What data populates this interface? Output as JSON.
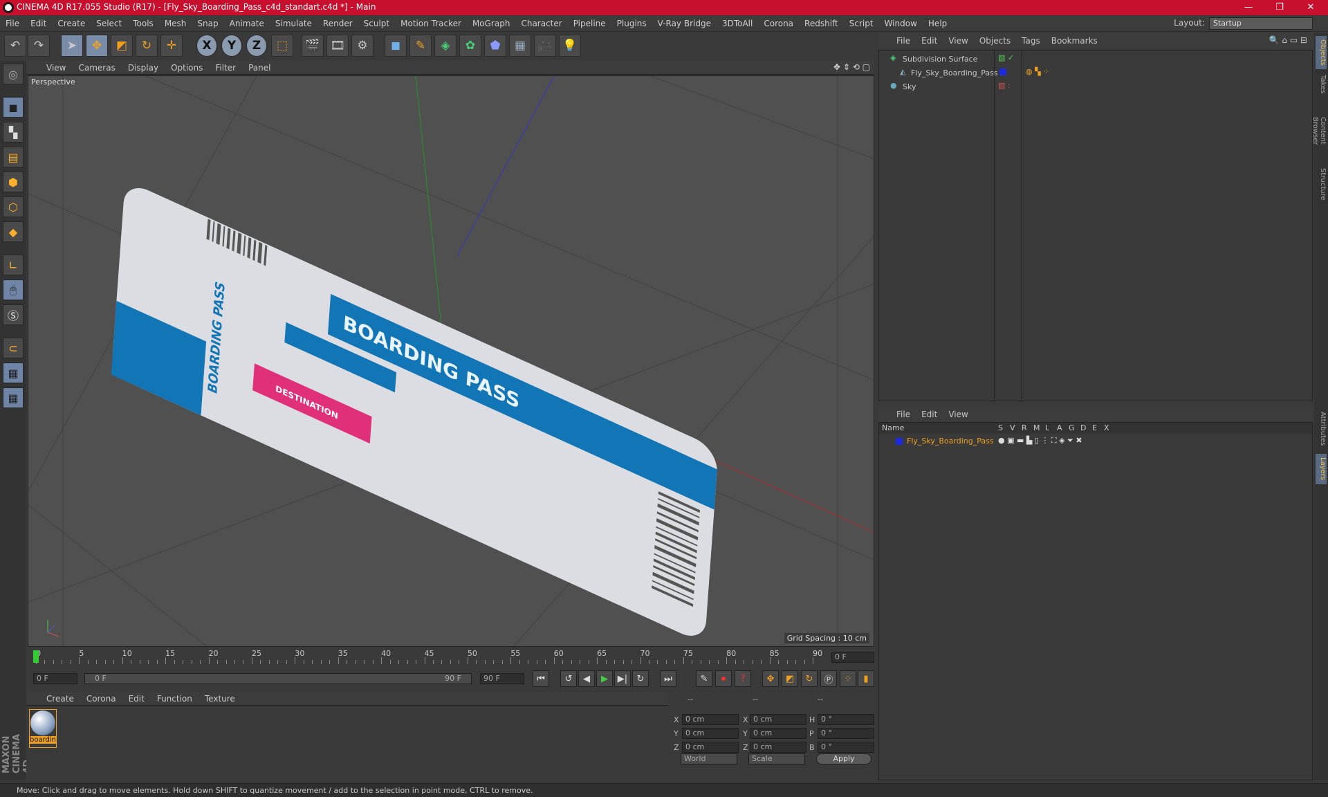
{
  "window": {
    "title": "CINEMA 4D R17.055 Studio (R17) - [Fly_Sky_Boarding_Pass_c4d_standart.c4d *] - Main",
    "minimize": "—",
    "restore": "❐",
    "close": "✕"
  },
  "menubar": {
    "items": [
      "File",
      "Edit",
      "Create",
      "Select",
      "Tools",
      "Mesh",
      "Snap",
      "Animate",
      "Simulate",
      "Render",
      "Sculpt",
      "Motion Tracker",
      "MoGraph",
      "Character",
      "Pipeline",
      "Plugins",
      "V-Ray Bridge",
      "3DToAll",
      "Corona",
      "Redshift",
      "Script",
      "Window",
      "Help"
    ],
    "layout_label": "Layout:",
    "layout_value": "Startup"
  },
  "viewport": {
    "menu": [
      "View",
      "Cameras",
      "Display",
      "Options",
      "Filter",
      "Panel"
    ],
    "label": "Perspective",
    "grid_spacing": "Grid Spacing : 10 cm",
    "ticket": {
      "title": "BOARDING PASS",
      "side_text": "BOARDING PASS",
      "stamp": "DESTINATION"
    }
  },
  "timeline": {
    "ticks": [
      "0",
      "5",
      "10",
      "15",
      "20",
      "25",
      "30",
      "35",
      "40",
      "45",
      "50",
      "55",
      "60",
      "65",
      "70",
      "75",
      "80",
      "85",
      "90"
    ],
    "current_frame": "0 F",
    "start_field": "0 F",
    "range_start": "0 F",
    "range_end": "90 F",
    "end_field": "90 F"
  },
  "material_manager": {
    "menu": [
      "Create",
      "Corona",
      "Edit",
      "Function",
      "Texture"
    ],
    "material_name": "boardin"
  },
  "coordinates": {
    "header": [
      "--",
      "--",
      "--"
    ],
    "rows": [
      {
        "a": "X",
        "av": "0 cm",
        "b": "X",
        "bv": "0 cm",
        "c": "H",
        "cv": "0 °"
      },
      {
        "a": "Y",
        "av": "0 cm",
        "b": "Y",
        "bv": "0 cm",
        "c": "P",
        "cv": "0 °"
      },
      {
        "a": "Z",
        "av": "0 cm",
        "b": "Z",
        "bv": "0 cm",
        "c": "B",
        "cv": "0 °"
      }
    ],
    "mode1": "World",
    "mode2": "Scale",
    "apply": "Apply"
  },
  "object_manager": {
    "menu": [
      "File",
      "Edit",
      "View",
      "Objects",
      "Tags",
      "Bookmarks"
    ],
    "objects": [
      {
        "name": "Subdivision Surface"
      },
      {
        "name": "Fly_Sky_Boarding_Pass"
      },
      {
        "name": "Sky"
      }
    ]
  },
  "layer_manager": {
    "menu": [
      "File",
      "Edit",
      "View"
    ],
    "columns": [
      "Name",
      "S",
      "V",
      "R",
      "M",
      "L",
      "A",
      "G",
      "D",
      "E",
      "X"
    ],
    "layers": [
      {
        "name": "Fly_Sky_Boarding_Pass"
      }
    ]
  },
  "right_tabs": [
    "Objects",
    "Takes",
    "Content Browser",
    "Structure",
    "Attributes",
    "Layers"
  ],
  "status": "Move: Click and drag to move elements. Hold down SHIFT to quantize movement / add to the selection in point mode, CTRL to remove.",
  "branding": "MAXON CINEMA 4D",
  "colors": {
    "accent": "#c8102e",
    "ticket_blue": "#1275b5",
    "ticket_pink": "#e0307a",
    "highlight": "#f0a020"
  }
}
